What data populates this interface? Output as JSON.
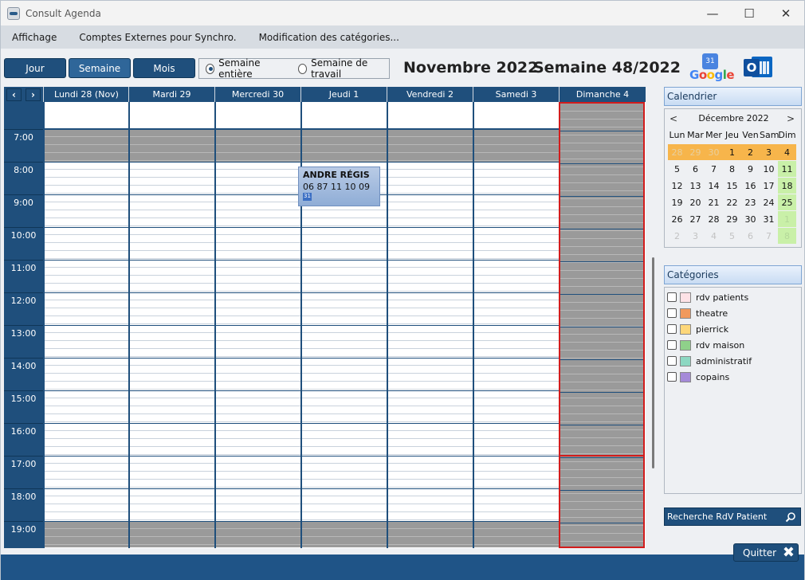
{
  "window": {
    "title": "Consult Agenda"
  },
  "menu": [
    "Affichage",
    "Comptes Externes pour Synchro.",
    "Modification des catégories..."
  ],
  "toolbar": {
    "view_day": "Jour",
    "view_week": "Semaine",
    "view_month": "Mois",
    "radio_full_week": "Semaine entière",
    "radio_work_week": "Semaine de travail",
    "radio_selected": "full_week",
    "month_label": "Novembre 2022",
    "week_label": "Semaine 48/2022",
    "google_label": "Google",
    "google_day": "31",
    "outlook_letter": "O"
  },
  "calendar": {
    "prev_icon": "‹",
    "next_icon": "›",
    "days": [
      "Lundi 28 (Nov)",
      "Mardi 29",
      "Mercredi 30",
      "Jeudi 1",
      "Vendredi 2",
      "Samedi 3",
      "Dimanche 4"
    ],
    "hours": [
      "7:00",
      "8:00",
      "9:00",
      "10:00",
      "11:00",
      "12:00",
      "13:00",
      "14:00",
      "15:00",
      "16:00",
      "17:00",
      "18:00",
      "19:00"
    ],
    "appointment": {
      "name": "ANDRE RÉGIS",
      "phone": "06 87 11 10 09",
      "icon": "31"
    }
  },
  "sidebar": {
    "calendar_header": "Calendrier",
    "mini_cal": {
      "title": "Décembre 2022",
      "dow": [
        "Lun",
        "Mar",
        "Mer",
        "Jeu",
        "Ven",
        "Sam",
        "Dim"
      ],
      "weeks": [
        [
          "28",
          "29",
          "30",
          "1",
          "2",
          "3",
          "4"
        ],
        [
          "5",
          "6",
          "7",
          "8",
          "9",
          "10",
          "11"
        ],
        [
          "12",
          "13",
          "14",
          "15",
          "16",
          "17",
          "18"
        ],
        [
          "19",
          "20",
          "21",
          "22",
          "23",
          "24",
          "25"
        ],
        [
          "26",
          "27",
          "28",
          "29",
          "30",
          "31",
          "1"
        ],
        [
          "2",
          "3",
          "4",
          "5",
          "6",
          "7",
          "8"
        ]
      ]
    },
    "categories_header": "Catégories",
    "categories": [
      {
        "label": "rdv patients",
        "color": "#fde2e6"
      },
      {
        "label": "theatre",
        "color": "#f1995c"
      },
      {
        "label": "pierrick",
        "color": "#fdd77a"
      },
      {
        "label": "rdv maison",
        "color": "#8fd18a"
      },
      {
        "label": "administratif",
        "color": "#8dd8c2"
      },
      {
        "label": "copains",
        "color": "#a58ad8"
      }
    ],
    "search_label": "Recherche RdV Patient"
  },
  "footer": {
    "quit_label": "Quitter"
  }
}
